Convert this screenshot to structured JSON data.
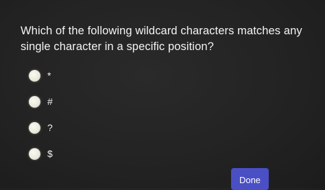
{
  "question": {
    "text": "Which of the following wildcard characters matches any single character in a specific position?"
  },
  "options": [
    {
      "label": "*"
    },
    {
      "label": "#"
    },
    {
      "label": "?"
    },
    {
      "label": "$"
    }
  ],
  "done_button": {
    "label": "Done"
  },
  "colors": {
    "background": "#242424",
    "text": "#f2f2f2",
    "radio": "#ecece0",
    "done_button": "#4a4fc4"
  }
}
